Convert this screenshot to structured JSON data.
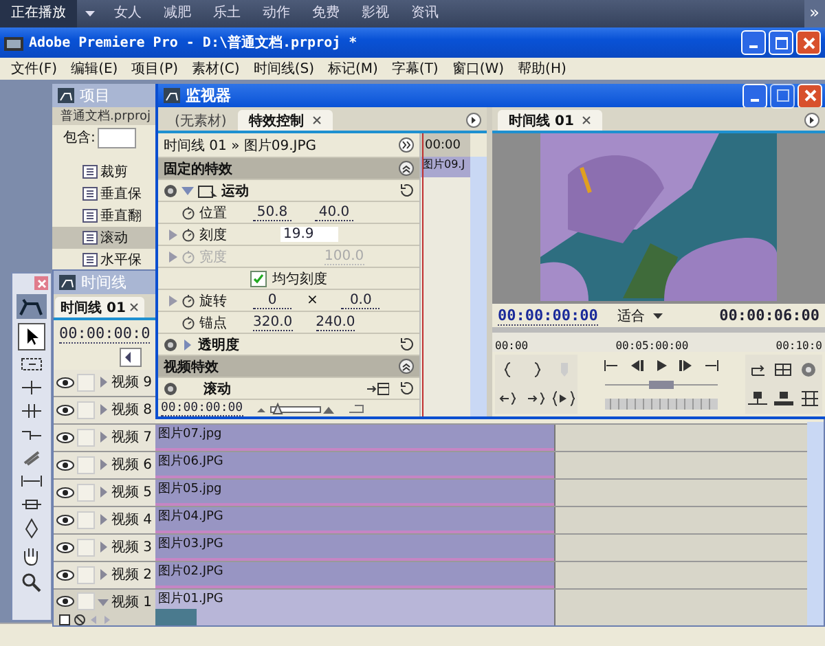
{
  "taskbar": {
    "tabs": [
      {
        "label": "正在播放",
        "selected": true
      },
      {
        "label": "女人",
        "selected": false
      },
      {
        "label": "减肥",
        "selected": false
      },
      {
        "label": "乐土",
        "selected": false
      },
      {
        "label": "动作",
        "selected": false
      },
      {
        "label": "免费",
        "selected": false
      },
      {
        "label": "影视",
        "selected": false
      },
      {
        "label": "资讯",
        "selected": false
      }
    ],
    "more": "»"
  },
  "window": {
    "title": "Adobe Premiere Pro - D:\\普通文档.prproj *"
  },
  "menu": [
    "文件(F)",
    "编辑(E)",
    "项目(P)",
    "素材(C)",
    "时间线(S)",
    "标记(M)",
    "字幕(T)",
    "窗口(W)",
    "帮助(H)"
  ],
  "project_panel": {
    "title": "项目",
    "tab": "普通文档.prproj",
    "filter_label": "包含:",
    "items": [
      {
        "label": "裁剪",
        "selected": false
      },
      {
        "label": "垂直保",
        "selected": false
      },
      {
        "label": "垂直翻",
        "selected": false
      },
      {
        "label": "滚动",
        "selected": true
      },
      {
        "label": "水平保",
        "selected": false
      }
    ]
  },
  "monitor": {
    "title": "监视器",
    "tabs": [
      {
        "label": "(无素材)",
        "selected": false
      },
      {
        "label": "特效控制",
        "selected": true
      }
    ],
    "clip_path": "时间线 01 » 图片09.JPG",
    "mini_timecode": "00:00",
    "clip_label": "图片09.J",
    "fixed_header": "固定的特效",
    "video_header": "视频特效",
    "rows": [
      {
        "kind": "effect",
        "label": "运动",
        "expanded": true
      },
      {
        "kind": "param",
        "label": "位置",
        "values": [
          "50.8",
          "40.0"
        ],
        "expandable": false,
        "disabled": false,
        "editing": false
      },
      {
        "kind": "param",
        "label": "刻度",
        "values": [
          "19.9"
        ],
        "expandable": true,
        "disabled": false,
        "editing": true
      },
      {
        "kind": "param",
        "label": "宽度",
        "values": [
          "100.0"
        ],
        "expandable": true,
        "disabled": true,
        "editing": false
      },
      {
        "kind": "checkbox",
        "label": "均匀刻度",
        "checked": true
      },
      {
        "kind": "param",
        "label": "旋转",
        "values": [
          "0",
          "0.0"
        ],
        "separator": "×",
        "expandable": true,
        "disabled": false,
        "editing": false
      },
      {
        "kind": "param",
        "label": "锚点",
        "values": [
          "320.0",
          "240.0"
        ],
        "expandable": false,
        "disabled": false,
        "editing": false
      },
      {
        "kind": "effect",
        "label": "透明度",
        "expanded": false
      }
    ],
    "video_effects": [
      {
        "label": "滚动"
      }
    ],
    "footer_timecode": "00:00:00:00",
    "program": {
      "tab": "时间线 01",
      "timecode": "00:00:00:00",
      "fit": "适合",
      "duration": "00:00:06:00",
      "ruler": [
        "00:00",
        "00:05:00:00",
        "00:10:0"
      ],
      "shuttle": {
        "level": 0.5
      }
    }
  },
  "timeline": {
    "title": "时间线",
    "tab": "时间线 01",
    "timecode": "00:00:00:0",
    "tracks": [
      {
        "label": "视频 9",
        "expanded": false
      },
      {
        "label": "视频 8",
        "expanded": false
      },
      {
        "label": "视频 7",
        "expanded": false,
        "clip": "图片07.jpg"
      },
      {
        "label": "视频 6",
        "expanded": false,
        "clip": "图片06.JPG"
      },
      {
        "label": "视频 5",
        "expanded": false,
        "clip": "图片05.jpg"
      },
      {
        "label": "视频 4",
        "expanded": false,
        "clip": "图片04.JPG"
      },
      {
        "label": "视频 3",
        "expanded": false,
        "clip": "图片03.JPG"
      },
      {
        "label": "视频 2",
        "expanded": false,
        "clip": "图片02.JPG"
      },
      {
        "label": "视频 1",
        "expanded": true,
        "clip": "图片01.JPG"
      }
    ]
  }
}
